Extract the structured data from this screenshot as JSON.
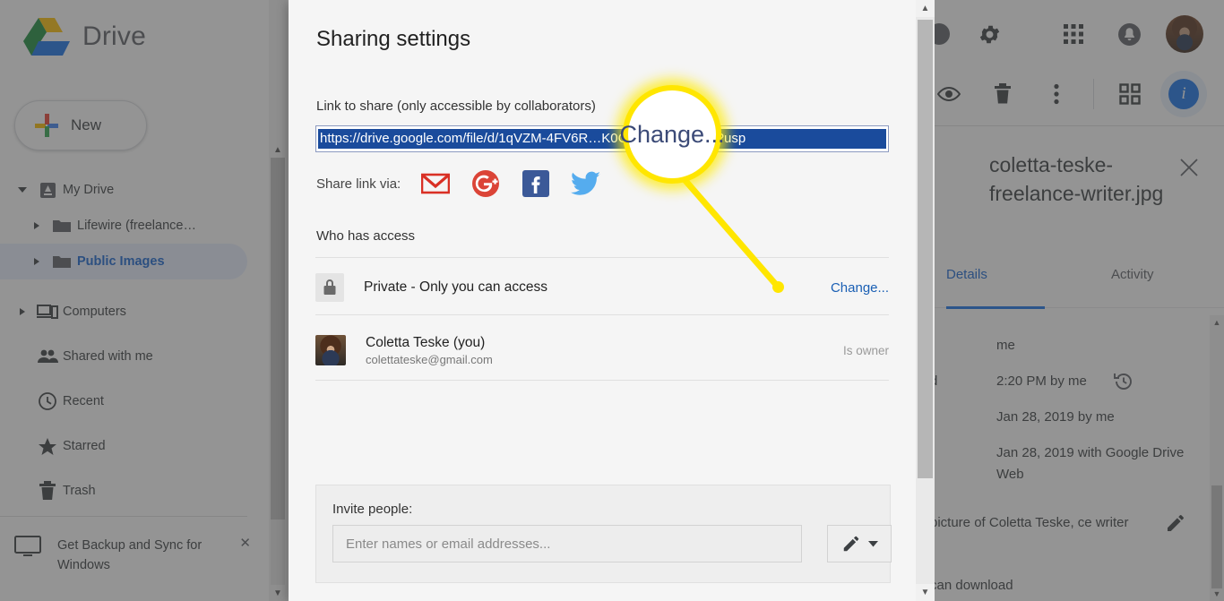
{
  "app": {
    "brand": "Drive",
    "new_button": "New",
    "sidebar": {
      "items": [
        {
          "label": "My Drive",
          "icon": "drive-icon",
          "caret": true,
          "selected": false,
          "indent": false
        },
        {
          "label": "Lifewire (freelance…",
          "icon": "folder-icon",
          "caret": true,
          "selected": false,
          "indent": true
        },
        {
          "label": "Public Images",
          "icon": "folder-icon",
          "caret": true,
          "selected": true,
          "indent": true
        },
        {
          "label": "Computers",
          "icon": "computers-icon",
          "caret": true,
          "selected": false,
          "indent": false
        },
        {
          "label": "Shared with me",
          "icon": "people-icon",
          "caret": false,
          "selected": false,
          "indent": false
        },
        {
          "label": "Recent",
          "icon": "clock-icon",
          "caret": false,
          "selected": false,
          "indent": false
        },
        {
          "label": "Starred",
          "icon": "star-icon",
          "caret": false,
          "selected": false,
          "indent": false
        },
        {
          "label": "Trash",
          "icon": "trash-icon",
          "caret": false,
          "selected": false,
          "indent": false
        }
      ],
      "promo": "Get Backup and Sync for Windows"
    },
    "topbar_icons": [
      "help-icon",
      "gear-icon",
      "apps-grid-icon",
      "notifications-icon",
      "account-avatar"
    ],
    "toolbar_icons": [
      "preview-eye-icon",
      "trash-icon",
      "more-vertical-icon",
      "grid-view-icon",
      "details-info-icon"
    ],
    "details": {
      "filename": "coletta-teske-freelance-writer.jpg",
      "close": "×",
      "tabs": [
        {
          "label": "Details",
          "active": true
        },
        {
          "label": "Activity",
          "active": false
        }
      ],
      "rows": [
        {
          "text": "me"
        },
        {
          "text": "2:20 PM by me",
          "icon": "history-icon"
        },
        {
          "text": "Jan 28, 2019 by me"
        },
        {
          "text": "Jan 28, 2019 with Google Drive Web"
        }
      ],
      "description": "picture of Coletta Teske, ce writer",
      "description_edit_icon": "pencil-icon",
      "partial_label_left": "d",
      "footer_partial": "can download"
    }
  },
  "dialog": {
    "title": "Sharing settings",
    "link_label": "Link to share (only accessible by collaborators)",
    "link_value": "https://drive.google.com/file/d/1qVZM-4FV6R…K0CfK6IaW0z/view?usp",
    "share_via_label": "Share link via:",
    "share_icons": [
      {
        "name": "gmail-icon",
        "color": "#d93025"
      },
      {
        "name": "google-plus-icon",
        "color": "#db4437"
      },
      {
        "name": "facebook-icon",
        "color": "#3b5998"
      },
      {
        "name": "twitter-icon",
        "color": "#55acee"
      }
    ],
    "who_has_access_label": "Who has access",
    "access_rows": [
      {
        "icon": "lock-icon",
        "title": "Private - Only you can access",
        "subtitle": "",
        "action": "Change...",
        "action_type": "link"
      },
      {
        "icon": "user-photo",
        "title": "Coletta Teske (you)",
        "subtitle": "colettateske@gmail.com",
        "action": "Is owner",
        "action_type": "text"
      }
    ],
    "invite": {
      "label": "Invite people:",
      "placeholder": "Enter names or email addresses...",
      "permission_icon": "pencil-icon",
      "dropdown_icon": "caret-down-icon"
    }
  },
  "callout": {
    "magnified_text": "Change...",
    "highlight_color": "#ffe600"
  }
}
